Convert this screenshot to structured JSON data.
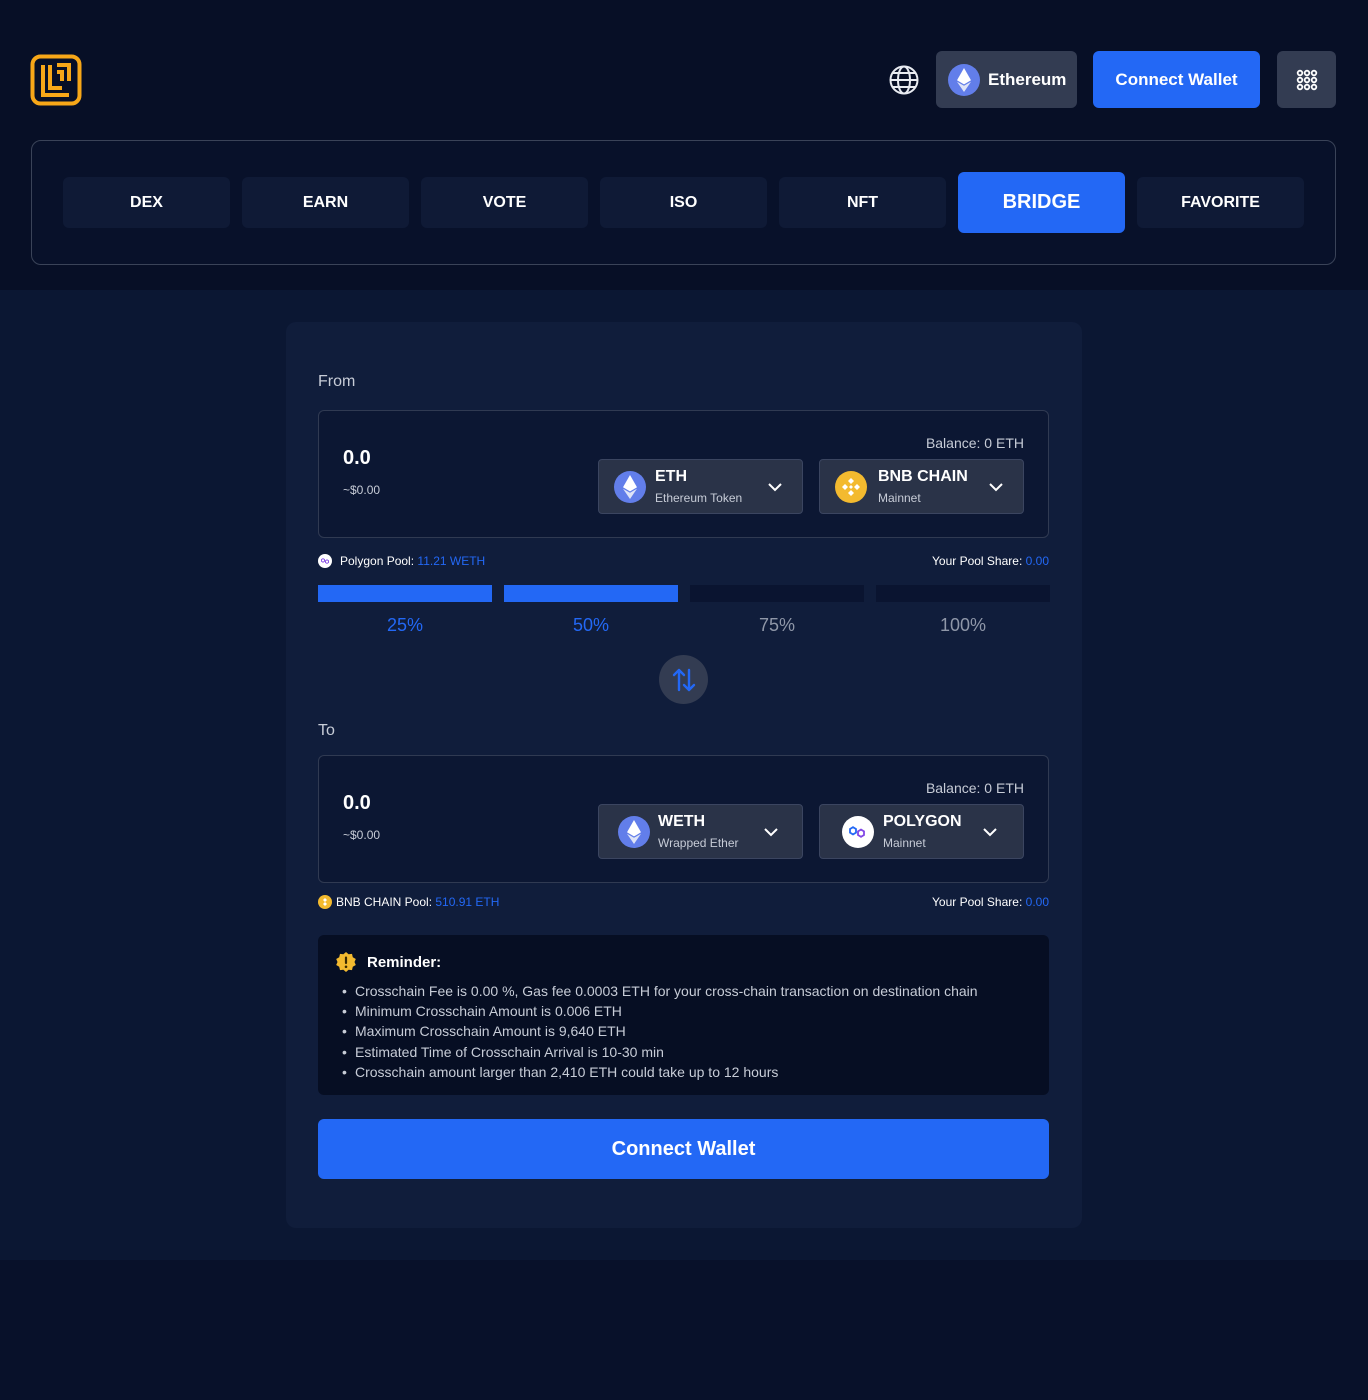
{
  "header": {
    "logo_icon": "brand-logo-icon",
    "language_icon": "globe-icon",
    "network": {
      "label": "Ethereum",
      "icon": "ethereum-icon"
    },
    "connect_wallet_label": "Connect Wallet",
    "apps_icon": "grid-dots-icon"
  },
  "tabs": [
    {
      "label": "DEX",
      "active": false
    },
    {
      "label": "EARN",
      "active": false
    },
    {
      "label": "VOTE",
      "active": false
    },
    {
      "label": "ISO",
      "active": false
    },
    {
      "label": "NFT",
      "active": false
    },
    {
      "label": "BRIDGE",
      "active": true
    },
    {
      "label": "FAVORITE",
      "active": false
    }
  ],
  "from": {
    "label": "From",
    "amount": "0.0",
    "usd": "~$0.00",
    "balance": "Balance: 0 ETH",
    "token": {
      "symbol": "ETH",
      "name": "Ethereum Token",
      "icon": "ethereum-icon"
    },
    "chain": {
      "name": "BNB CHAIN",
      "network": "Mainnet",
      "icon": "bnb-chain-icon"
    }
  },
  "from_pool": {
    "label": "Polygon Pool:",
    "value": "11.21 WETH",
    "share_label": "Your Pool Share:",
    "share_value": "0.00",
    "icon": "polygon-icon"
  },
  "percent": {
    "selected_fraction": 0.5,
    "options": [
      {
        "label": "25%",
        "active": true
      },
      {
        "label": "50%",
        "active": true
      },
      {
        "label": "75%",
        "active": false
      },
      {
        "label": "100%",
        "active": false
      }
    ]
  },
  "swap_icon": "swap-arrows-icon",
  "to": {
    "label": "To",
    "amount": "0.0",
    "usd": "~$0.00",
    "balance": "Balance: 0 ETH",
    "token": {
      "symbol": "WETH",
      "name": "Wrapped Ether",
      "icon": "ethereum-icon"
    },
    "chain": {
      "name": "POLYGON",
      "network": "Mainnet",
      "icon": "polygon-icon"
    }
  },
  "to_pool": {
    "label": "BNB CHAIN Pool:",
    "value": "510.91 ETH",
    "share_label": "Your Pool Share:",
    "share_value": "0.00",
    "icon": "bnb-chain-icon"
  },
  "reminder": {
    "icon": "warning-icon",
    "title": "Reminder:",
    "items": [
      "Crosschain Fee is 0.00 %, Gas fee 0.0003 ETH for your cross-chain transaction on destination chain",
      "Minimum Crosschain Amount is 0.006 ETH",
      "Maximum Crosschain Amount is 9,640 ETH",
      "Estimated Time of Crosschain Arrival is 10-30 min",
      "Crosschain amount larger than 2,410 ETH could take up to 12 hours"
    ]
  },
  "main_button_label": "Connect Wallet",
  "colors": {
    "accent": "#2368f5",
    "background": "#08112a",
    "card": "#101d3b",
    "brand": "#f7a718",
    "bnb": "#f3ba2f",
    "ethereum": "#627eea"
  }
}
